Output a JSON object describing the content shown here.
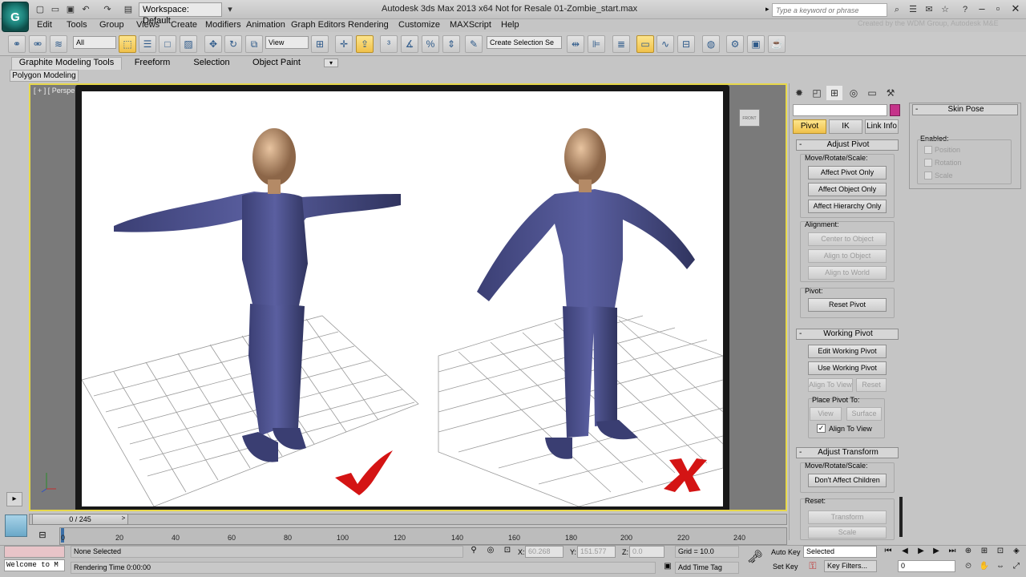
{
  "titlebar": {
    "workspace": "Workspace: Default",
    "title": "Autodesk 3ds Max  2013 x64    Not for Resale    01-Zombie_start.max",
    "search_placeholder": "Type a keyword or phrase"
  },
  "menu": [
    "Edit",
    "Tools",
    "Group",
    "Views",
    "Create",
    "Modifiers",
    "Animation",
    "Graph Editors",
    "Rendering",
    "Customize",
    "MAXScript",
    "Help"
  ],
  "watermark": "Created by the WDM Group, Autodesk M&E",
  "toolbar": {
    "filter": "All",
    "refcoord": "View",
    "selection_set": "Create Selection Se"
  },
  "ribbon": {
    "tabs": [
      "Graphite Modeling Tools",
      "Freeform",
      "Selection",
      "Object Paint"
    ],
    "sub": "Polygon Modeling"
  },
  "viewport": {
    "label": "[ + ] [ Perspe"
  },
  "command_panel": {
    "hierarchy_tabs": [
      "Pivot",
      "IK",
      "Link Info"
    ],
    "adjust_pivot": {
      "title": "Adjust Pivot",
      "move_label": "Move/Rotate/Scale:",
      "btn1": "Affect Pivot Only",
      "btn2": "Affect Object Only",
      "btn3": "Affect Hierarchy Only",
      "align_label": "Alignment:",
      "align1": "Center to Object",
      "align2": "Align to Object",
      "align3": "Align to World",
      "pivot_label": "Pivot:",
      "reset": "Reset Pivot"
    },
    "working_pivot": {
      "title": "Working Pivot",
      "edit": "Edit Working Pivot",
      "use": "Use Working Pivot",
      "align_view": "Align To View",
      "reset": "Reset",
      "place_label": "Place Pivot To:",
      "view": "View",
      "surface": "Surface",
      "align_to_view_check": "Align To View"
    },
    "adjust_transform": {
      "title": "Adjust Transform",
      "move_label": "Move/Rotate/Scale:",
      "dont_affect": "Don't Affect Children",
      "reset_label": "Reset:",
      "transform": "Transform",
      "scale": "Scale"
    }
  },
  "skin_pose": {
    "title": "Skin Pose",
    "enabled": "Enabled:",
    "position": "Position",
    "rotation": "Rotation",
    "scale": "Scale"
  },
  "timeline": {
    "frame": "0 / 245",
    "ticks": [
      "0",
      "20",
      "40",
      "60",
      "80",
      "100",
      "120",
      "140",
      "160",
      "180",
      "200",
      "220",
      "240"
    ]
  },
  "status": {
    "maxscript": "Welcome to M",
    "selection": "None Selected",
    "render_time": "Rendering Time  0:00:00",
    "x_label": "X:",
    "x": "60.268",
    "y_label": "Y:",
    "y": "151.577",
    "z_label": "Z:",
    "z": "0.0",
    "grid": "Grid = 10.0",
    "add_time_tag": "Add Time Tag",
    "auto_key": "Auto Key",
    "set_key": "Set Key",
    "key_select": "Selected",
    "key_filters": "Key Filters...",
    "frame_field": "0"
  }
}
